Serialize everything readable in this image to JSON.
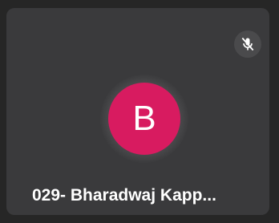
{
  "tile": {
    "participant_name": "029- Bharadwaj Kapp...",
    "avatar_initial": "B",
    "avatar_color": "#d81b60",
    "mic_status_icon": "mic-off-icon"
  }
}
